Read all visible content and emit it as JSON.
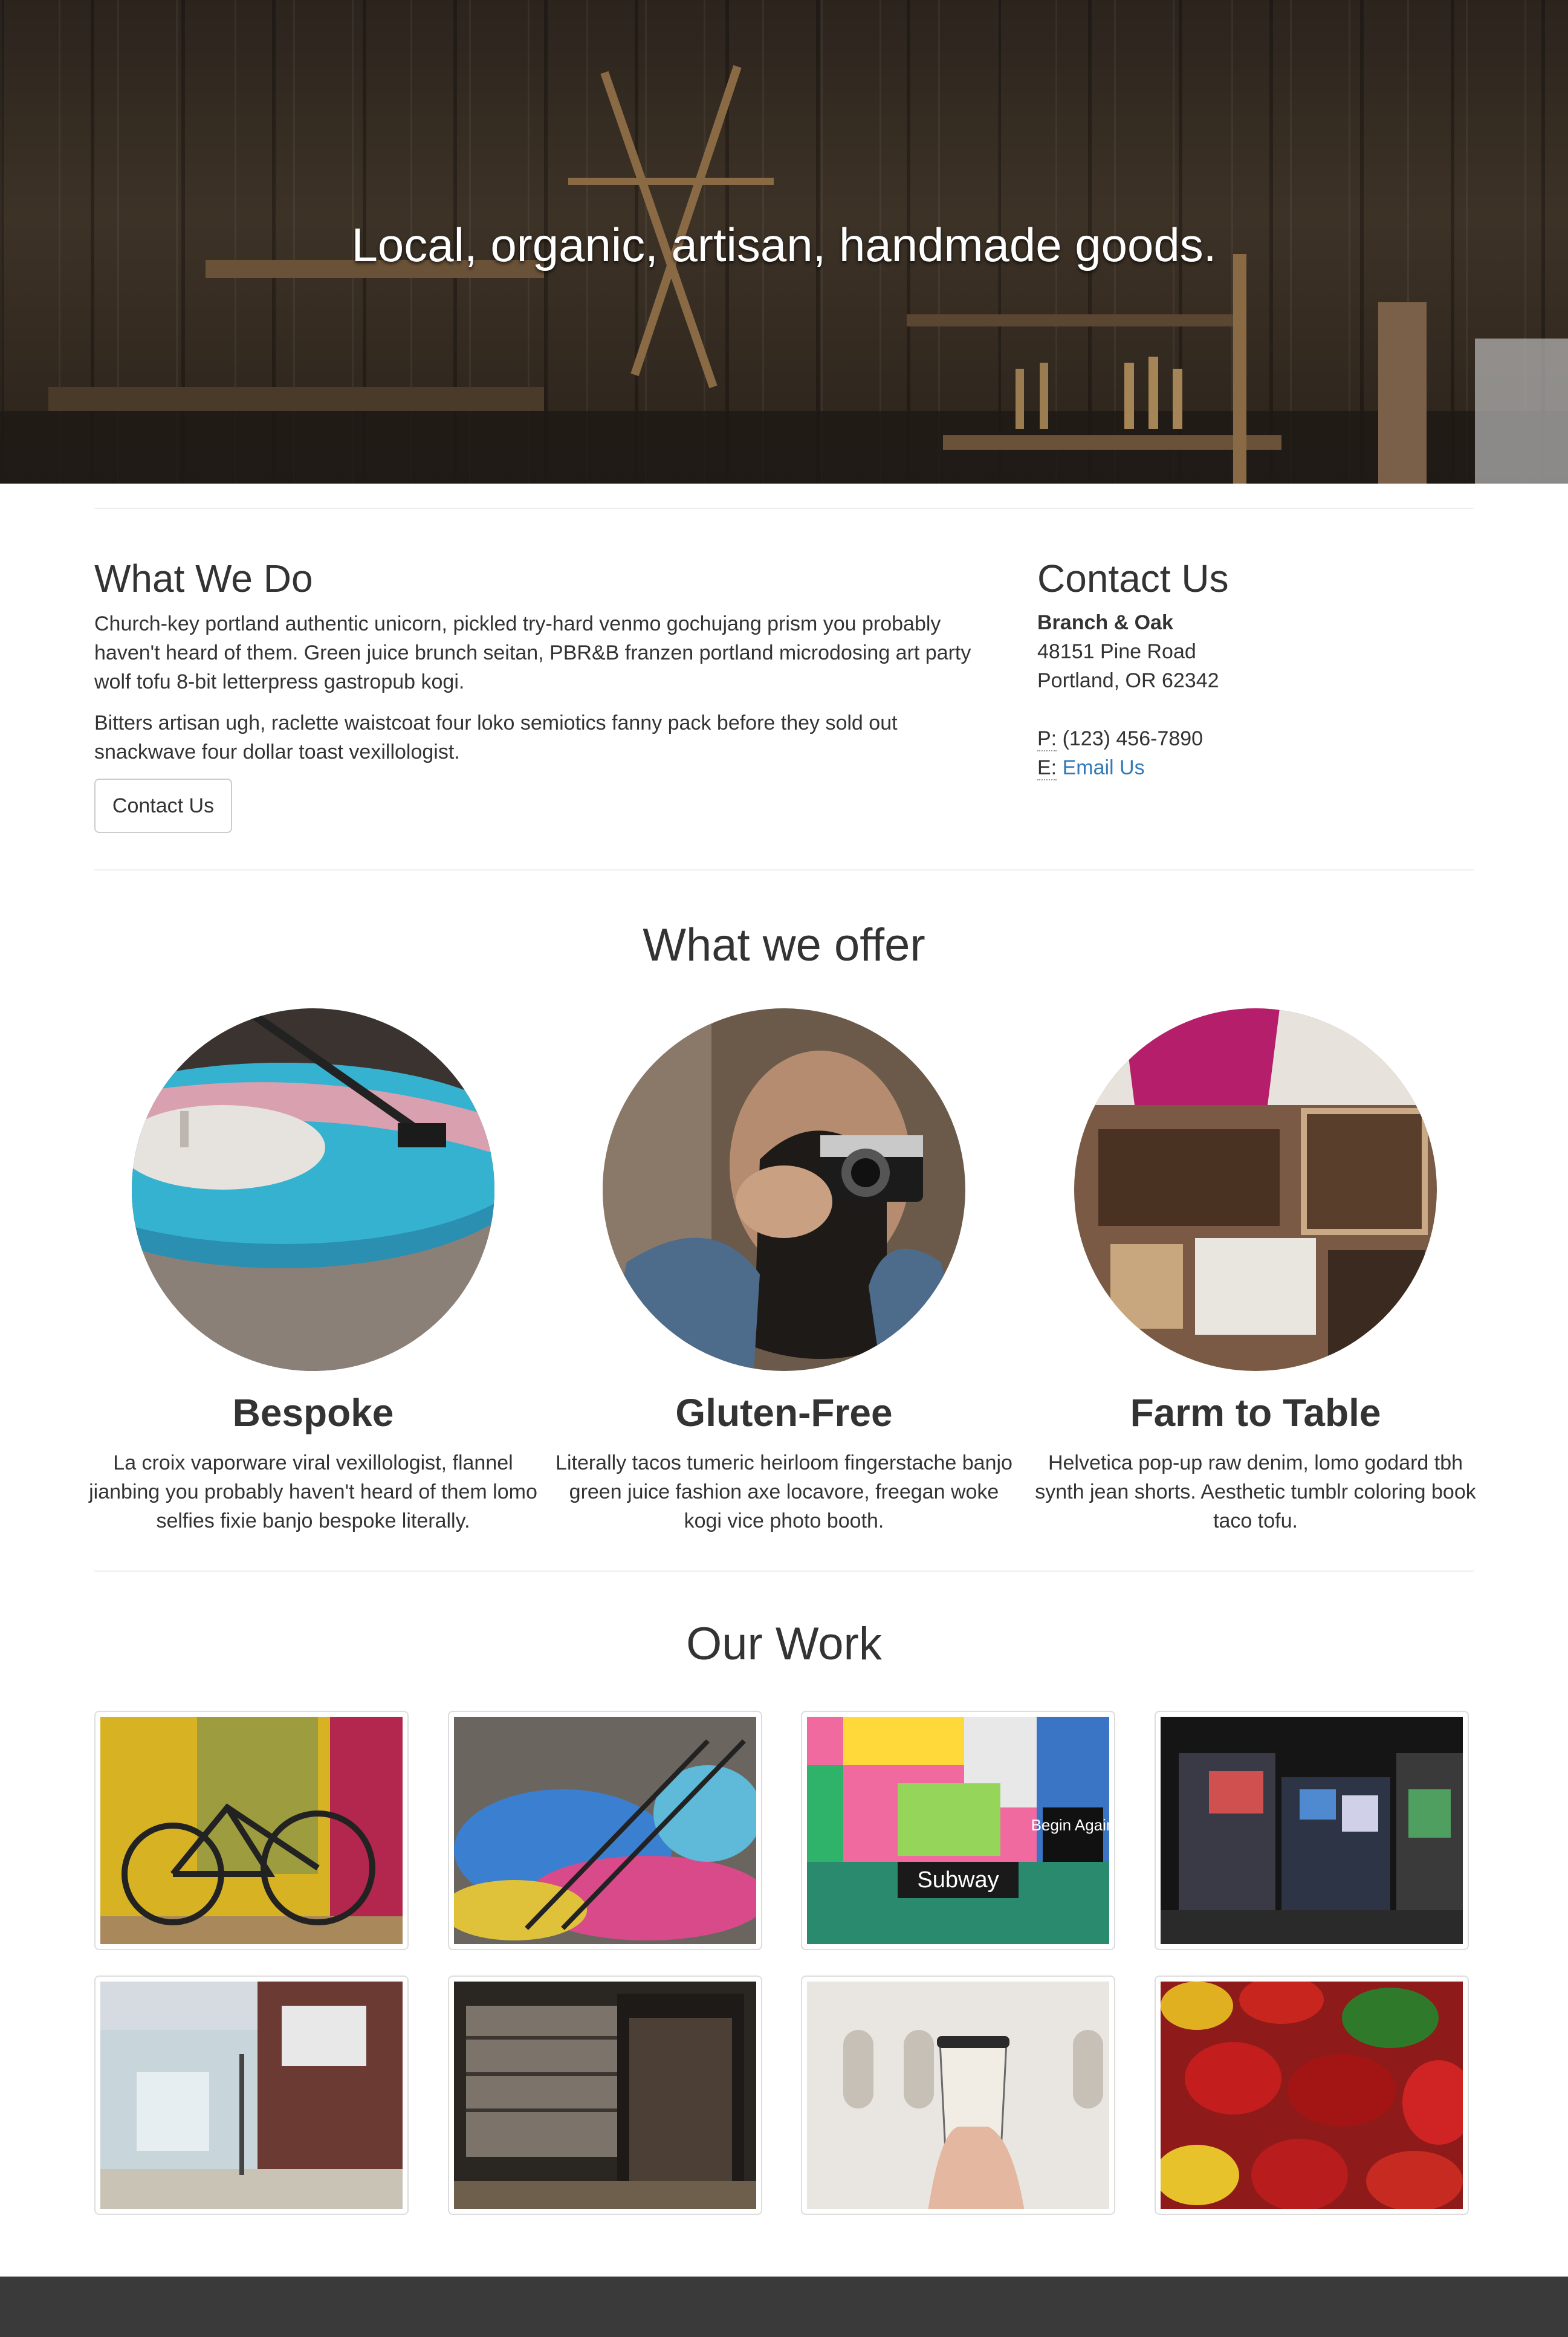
{
  "hero": {
    "title": "Local, organic, artisan, handmade goods."
  },
  "what_we_do": {
    "title": "What We Do",
    "paragraphs": [
      "Church-key portland authentic unicorn, pickled try-hard venmo gochujang prism you probably haven't heard of them. Green juice brunch seitan, PBR&B franzen portland microdosing art party wolf tofu 8-bit letterpress gastropub kogi.",
      "Bitters artisan ugh, raclette waistcoat four loko semiotics fanny pack before they sold out snackwave four dollar toast vexillologist."
    ],
    "button_label": "Contact Us"
  },
  "contact": {
    "title": "Contact Us",
    "company": "Branch & Oak",
    "address_line1": "48151 Pine Road",
    "address_line2": "Portland, OR 62342",
    "phone_prefix": "P:",
    "phone": "(123) 456-7890",
    "email_prefix": "E:",
    "email_label": "Email Us",
    "link_color": "#337ab7"
  },
  "offer": {
    "title": "What we offer",
    "items": [
      {
        "title": "Bespoke",
        "text": "La croix vaporware viral vexillologist, flannel jianbing you probably haven't heard of them lomo selfies fixie banjo bespoke literally.",
        "image": "turntable-photo"
      },
      {
        "title": "Gluten-Free",
        "text": "Literally tacos tumeric heirloom fingerstache banjo green juice fashion axe locavore, freegan woke kogi vice photo booth.",
        "image": "photographer-photo"
      },
      {
        "title": "Farm to Table",
        "text": "Helvetica pop-up raw denim, lomo godard tbh synth jean shorts. Aesthetic tumblr coloring book taco tofu.",
        "image": "leather-workshop-photo"
      }
    ]
  },
  "work": {
    "title": "Our Work",
    "images": [
      {
        "name": "bicycle-wall-photo"
      },
      {
        "name": "graffiti-stairs-photo"
      },
      {
        "name": "subway-posters-photo",
        "sign_text": "Subway",
        "poster_text": "Begin Again"
      },
      {
        "name": "city-night-photo"
      },
      {
        "name": "street-building-photo"
      },
      {
        "name": "shop-shelves-photo"
      },
      {
        "name": "coffee-cup-photo"
      },
      {
        "name": "peppers-photo"
      }
    ]
  },
  "footer": {
    "background": "#3a3a3a"
  }
}
